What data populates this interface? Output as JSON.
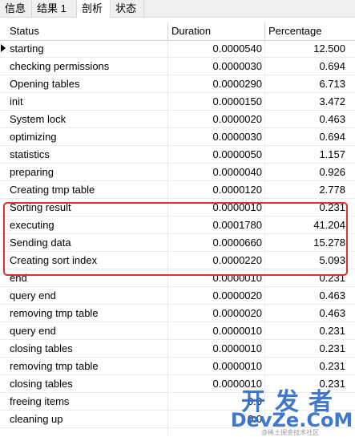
{
  "tabs": [
    {
      "label": "信息",
      "active": false
    },
    {
      "label": "结果 1",
      "active": false
    },
    {
      "label": "剖析",
      "active": true
    },
    {
      "label": "状态",
      "active": false
    }
  ],
  "columns": [
    "Status",
    "Duration",
    "Percentage"
  ],
  "rows": [
    {
      "status": "starting",
      "duration": "0.0000540",
      "percentage": "12.500"
    },
    {
      "status": "checking permissions",
      "duration": "0.0000030",
      "percentage": "0.694"
    },
    {
      "status": "Opening tables",
      "duration": "0.0000290",
      "percentage": "6.713"
    },
    {
      "status": "init",
      "duration": "0.0000150",
      "percentage": "3.472"
    },
    {
      "status": "System lock",
      "duration": "0.0000020",
      "percentage": "0.463"
    },
    {
      "status": "optimizing",
      "duration": "0.0000030",
      "percentage": "0.694"
    },
    {
      "status": "statistics",
      "duration": "0.0000050",
      "percentage": "1.157"
    },
    {
      "status": "preparing",
      "duration": "0.0000040",
      "percentage": "0.926"
    },
    {
      "status": "Creating tmp table",
      "duration": "0.0000120",
      "percentage": "2.778"
    },
    {
      "status": "Sorting result",
      "duration": "0.0000010",
      "percentage": "0.231"
    },
    {
      "status": "executing",
      "duration": "0.0001780",
      "percentage": "41.204"
    },
    {
      "status": "Sending data",
      "duration": "0.0000660",
      "percentage": "15.278"
    },
    {
      "status": "Creating sort index",
      "duration": "0.0000220",
      "percentage": "5.093"
    },
    {
      "status": "end",
      "duration": "0.0000010",
      "percentage": "0.231"
    },
    {
      "status": "query end",
      "duration": "0.0000020",
      "percentage": "0.463"
    },
    {
      "status": "removing tmp table",
      "duration": "0.0000020",
      "percentage": "0.463"
    },
    {
      "status": "query end",
      "duration": "0.0000010",
      "percentage": "0.231"
    },
    {
      "status": "closing tables",
      "duration": "0.0000010",
      "percentage": "0.231"
    },
    {
      "status": "removing tmp table",
      "duration": "0.0000010",
      "percentage": "0.231"
    },
    {
      "status": "closing tables",
      "duration": "0.0000010",
      "percentage": "0.231"
    },
    {
      "status": "freeing items",
      "duration": "0.0",
      "percentage": ""
    },
    {
      "status": "cleaning up",
      "duration": "0.0",
      "percentage": ""
    }
  ],
  "selected_row_index": 0,
  "highlight_color": "#d9312b",
  "watermark": {
    "cn": "开发者",
    "en": "DevZe.CoM",
    "small": "@稀土掘金技术社区"
  }
}
